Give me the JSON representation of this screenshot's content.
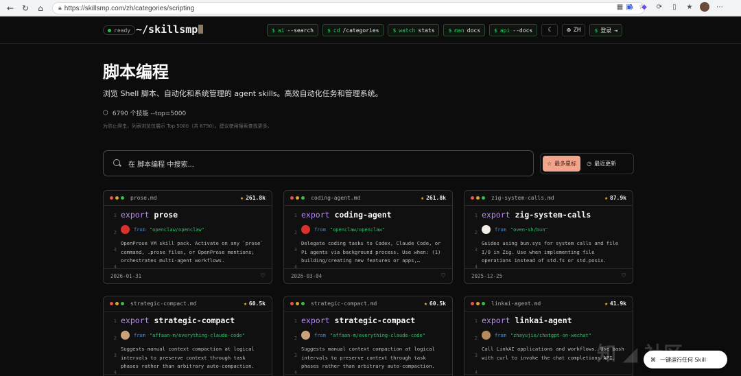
{
  "browser": {
    "url": "https://skillsmp.com/zh/categories/scripting"
  },
  "header": {
    "status": "ready",
    "logo": "~/skillsmp",
    "commands": [
      {
        "prefix": "$",
        "cmd": "ai",
        "arg": "--search"
      },
      {
        "prefix": "$",
        "cmd": "cd",
        "arg": "/categories"
      },
      {
        "prefix": "$",
        "cmd": "watch",
        "arg": "stats"
      },
      {
        "prefix": "$",
        "cmd": "man",
        "arg": "docs"
      },
      {
        "prefix": "$",
        "cmd": "api",
        "arg": "--docs"
      }
    ],
    "lang": "ZH",
    "login": "登录"
  },
  "hero": {
    "title": "脚本编程",
    "description": "浏览 Shell 脚本、自动化和系统管理的 agent skills。高效自动化任务和管理系统。",
    "count": "6790 个技能 --top=5000",
    "note": "为防止爬虫，列表浏览仅展示 Top 5000（共 6790），建议使用搜索查找更多。"
  },
  "search": {
    "placeholder": "在 脚本编程 中搜索..."
  },
  "sort": {
    "most_stars": "最多星标",
    "recent": "最近更新"
  },
  "cards": [
    {
      "file": "prose.md",
      "stars": "261.8k",
      "name": "prose",
      "repo": "\"openclaw/openclaw\"",
      "summary": "OpenProse VM skill pack. Activate on any `prose` command, .prose files, or OpenProse mentions; orchestrates multi-agent workflows.",
      "date": "2026-01-31",
      "avatar_color": "#d9312b"
    },
    {
      "file": "coding-agent.md",
      "stars": "261.8k",
      "name": "coding-agent",
      "repo": "\"openclaw/openclaw\"",
      "summary": "Delegate coding tasks to Codex, Claude Code, or Pi agents via background process. Use when: (1) building/creating new features or apps,…",
      "date": "2026-03-04",
      "avatar_color": "#d9312b"
    },
    {
      "file": "zig-system-calls.md",
      "stars": "87.9k",
      "name": "zig-system-calls",
      "repo": "\"oven-sh/bun\"",
      "summary": "Guides using bun.sys for system calls and file I/O in Zig. Use when implementing file operations instead of std.fs or std.posix.",
      "date": "2025-12-25",
      "avatar_color": "#f3efe6"
    },
    {
      "file": "strategic-compact.md",
      "stars": "60.5k",
      "name": "strategic-compact",
      "repo": "\"affaan-m/everything-claude-code\"",
      "summary": "Suggests manual context compaction at logical intervals to preserve context through task phases rather than arbitrary auto-compaction.",
      "date": "",
      "avatar_color": "#c9a27a"
    },
    {
      "file": "strategic-compact.md",
      "stars": "60.5k",
      "name": "strategic-compact",
      "repo": "\"affaan-m/everything-claude-code\"",
      "summary": "Suggests manual context compaction at logical intervals to preserve context through task phases rather than arbitrary auto-compaction.",
      "date": "",
      "avatar_color": "#c9a27a"
    },
    {
      "file": "linkai-agent.md",
      "stars": "41.9k",
      "name": "linkai-agent",
      "repo": "\"zhayujie/chatgpt-on-wechat\"",
      "summary": "Call LinkAI applications and workflows. Use bash with curl to invoke the chat completions API.",
      "date": "",
      "avatar_color": "#b58a5e"
    }
  ],
  "labels": {
    "export": "export",
    "from": "from"
  },
  "floating": {
    "label": "一键运行任何 Skill"
  },
  "colors": {
    "accent_green": "#2ec26a",
    "keyword_purple": "#b98cf5",
    "sort_active": "#f2a48d"
  }
}
